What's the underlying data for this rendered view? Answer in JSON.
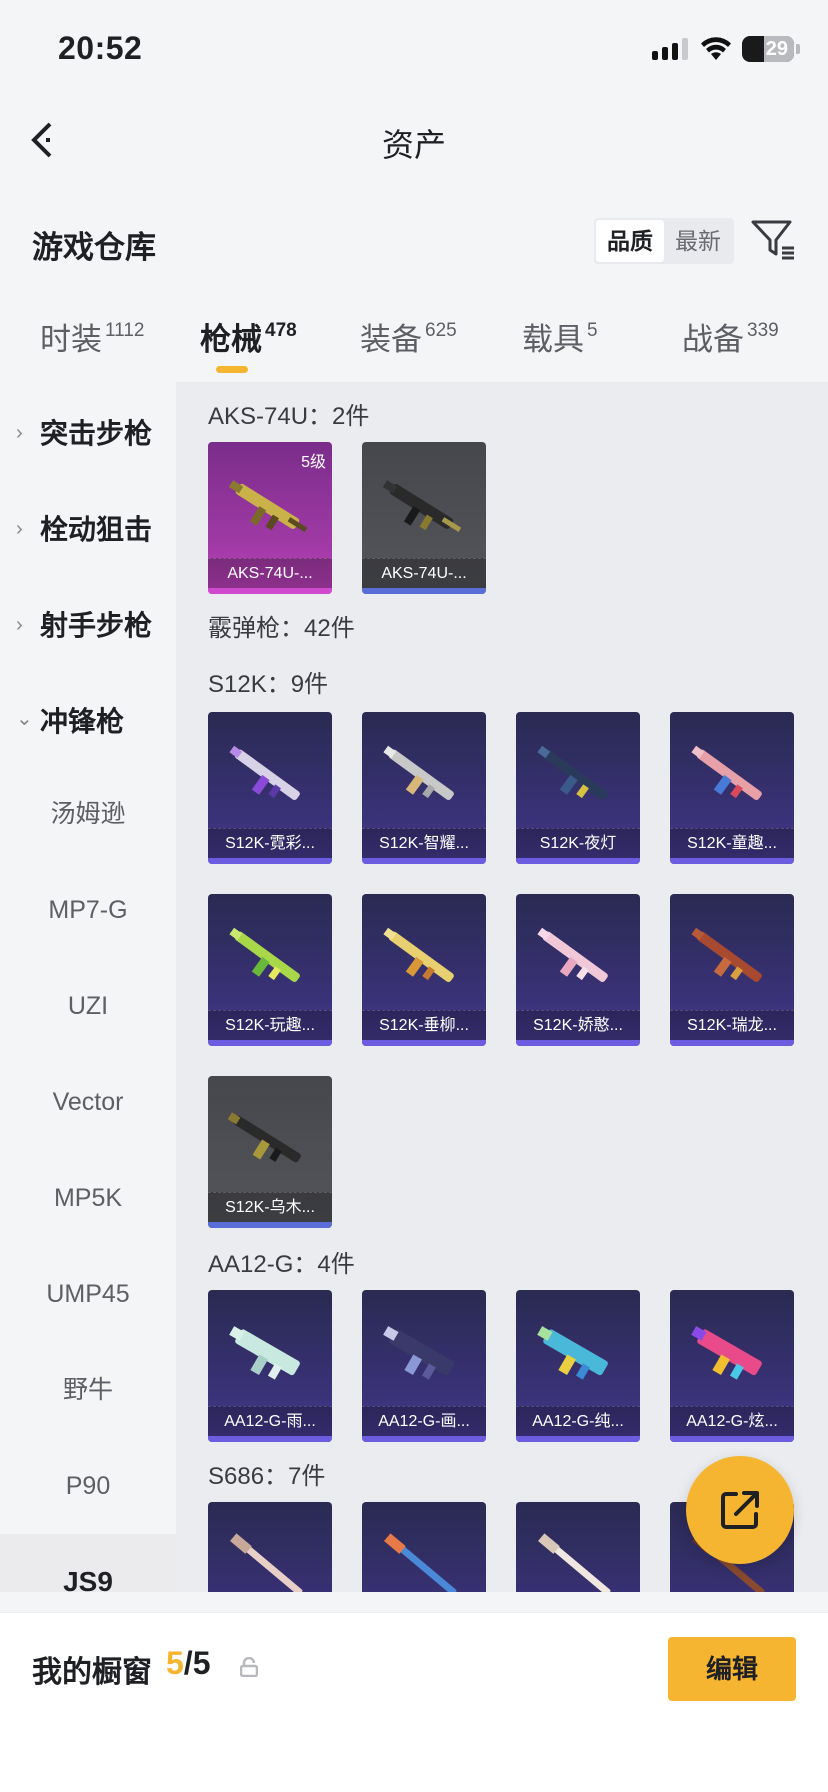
{
  "status": {
    "time": "20:52",
    "battery": "29"
  },
  "nav": {
    "title": "资产"
  },
  "section": {
    "title": "游戏仓库",
    "sort_quality": "品质",
    "sort_newest": "最新"
  },
  "tabs": [
    {
      "label": "时装",
      "count": "1112"
    },
    {
      "label": "枪械",
      "count": "478"
    },
    {
      "label": "装备",
      "count": "625"
    },
    {
      "label": "载具",
      "count": "5"
    },
    {
      "label": "战备",
      "count": "339"
    }
  ],
  "sidebar": {
    "categories": [
      "突击步枪",
      "栓动狙击",
      "射手步枪",
      "冲锋枪"
    ],
    "subs": [
      "汤姆逊",
      "MP7-G",
      "UZI",
      "Vector",
      "MP5K",
      "UMP45",
      "野牛",
      "P90",
      "JS9"
    ]
  },
  "groups": {
    "aks": "AKS-74U：2件",
    "shotgun": "霰弹枪：42件",
    "s12k": "S12K：9件",
    "aa12": "AA12-G：4件",
    "s686": "S686：7件"
  },
  "cards": {
    "aks": [
      {
        "label": "AKS-74U-...",
        "level": "5级"
      },
      {
        "label": "AKS-74U-..."
      }
    ],
    "s12k": [
      {
        "label": "S12K-霓彩..."
      },
      {
        "label": "S12K-智耀..."
      },
      {
        "label": "S12K-夜灯"
      },
      {
        "label": "S12K-童趣..."
      },
      {
        "label": "S12K-玩趣..."
      },
      {
        "label": "S12K-垂柳..."
      },
      {
        "label": "S12K-娇憨..."
      },
      {
        "label": "S12K-瑞龙..."
      },
      {
        "label": "S12K-乌木..."
      }
    ],
    "aa12": [
      {
        "label": "AA12-G-雨..."
      },
      {
        "label": "AA12-G-画..."
      },
      {
        "label": "AA12-G-纯..."
      },
      {
        "label": "AA12-G-炫..."
      }
    ]
  },
  "bottom": {
    "title": "我的橱窗",
    "count_current": "5",
    "count_sep": "/5",
    "edit_label": "编辑"
  },
  "colors": {
    "accent": "#f5b531",
    "card_purple": "#3a3278",
    "card_magenta": "#a23aa6",
    "card_grey": "#505156"
  }
}
